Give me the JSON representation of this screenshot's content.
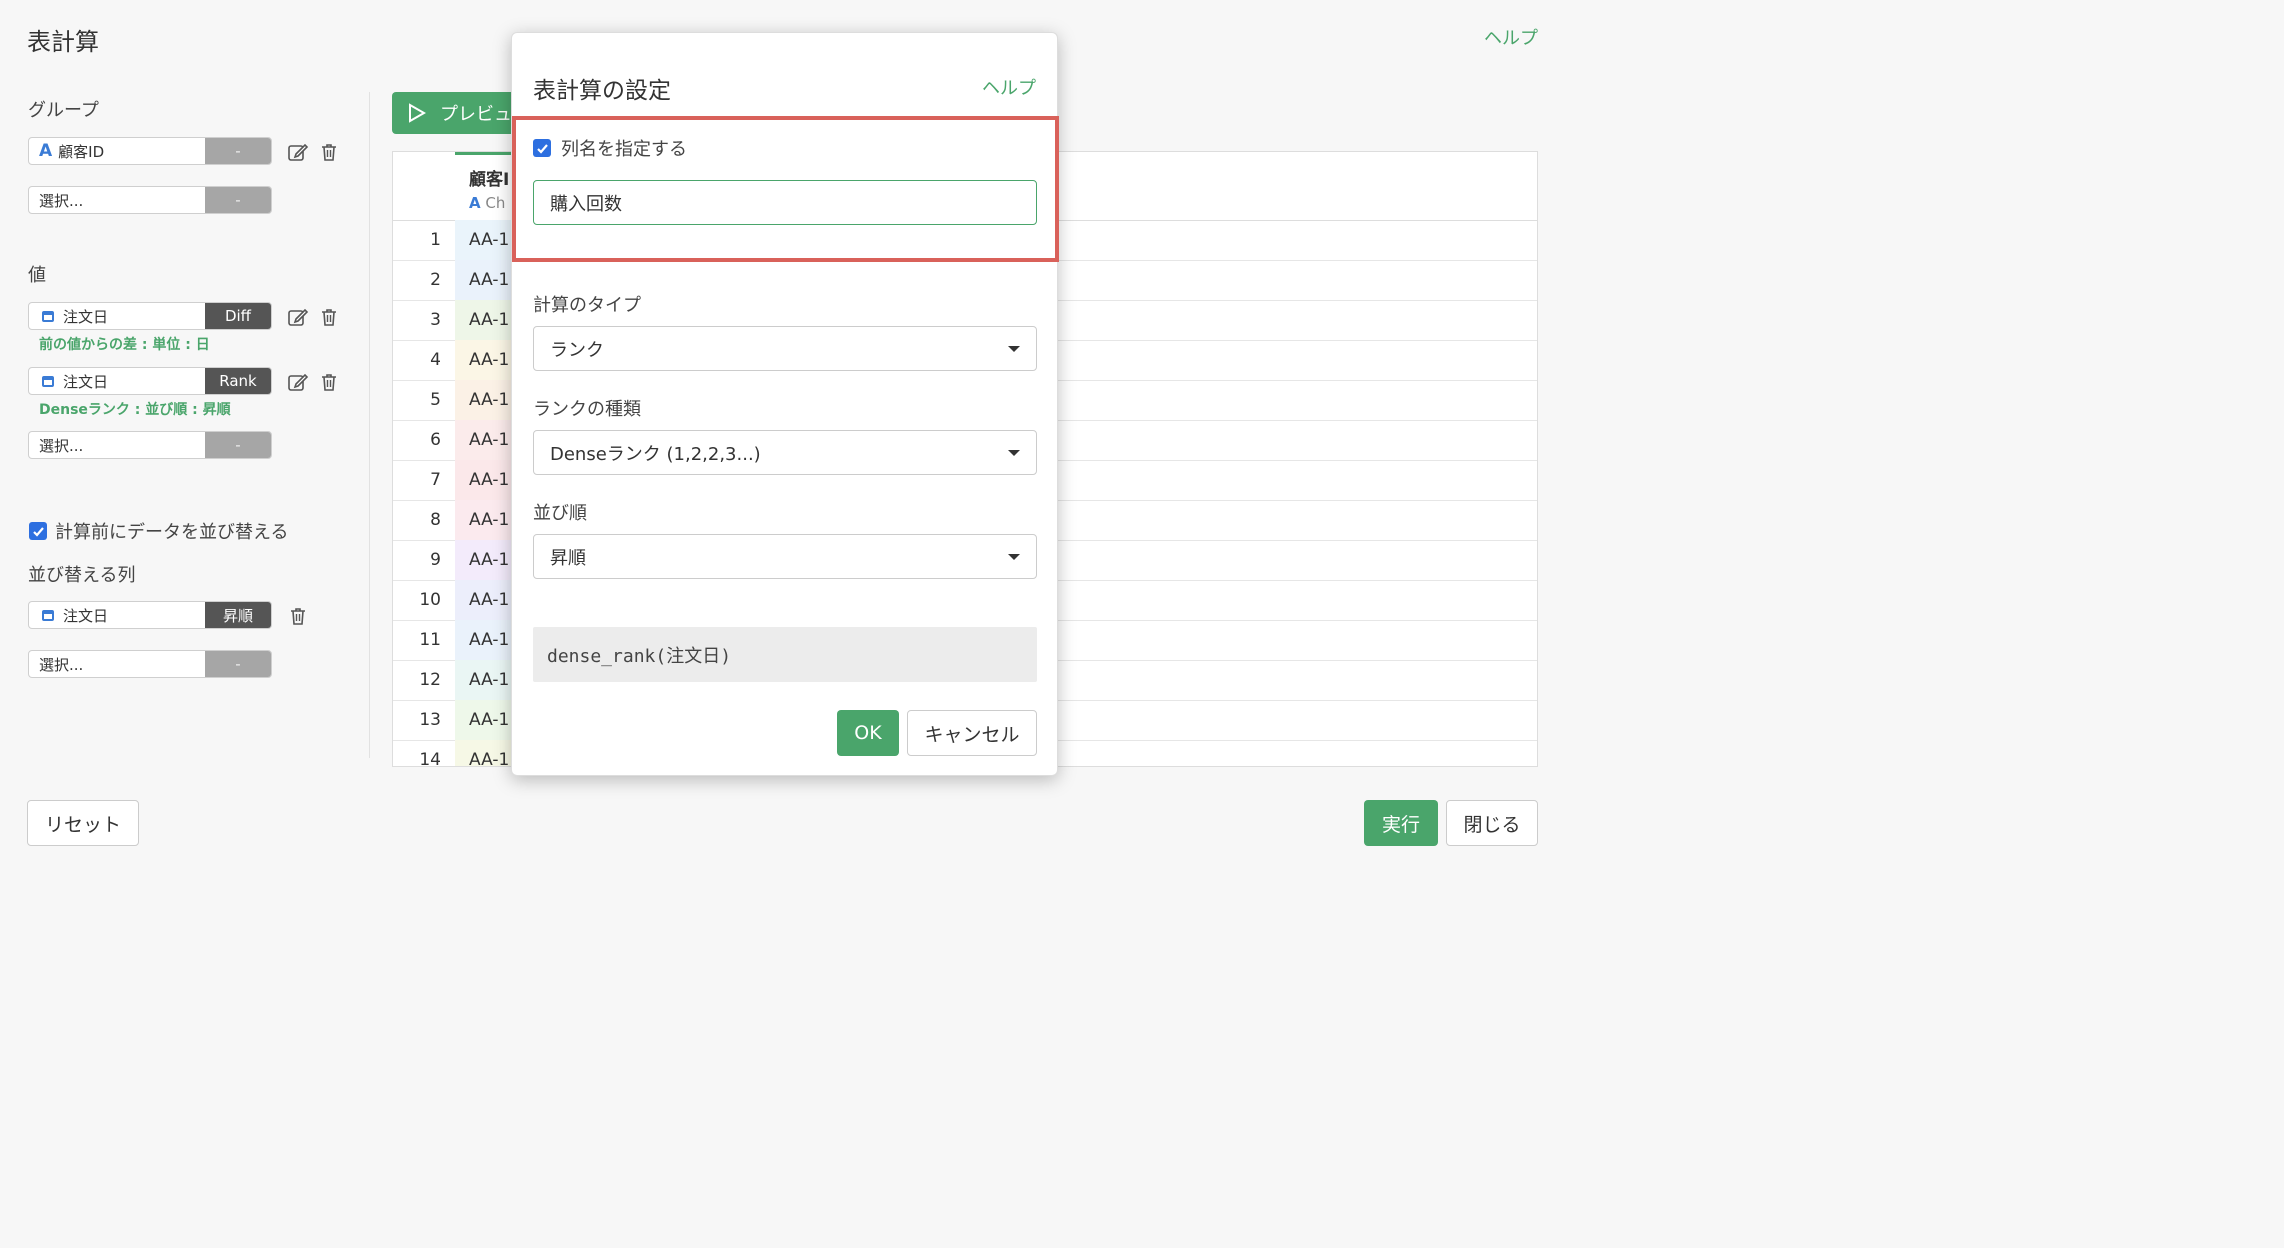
{
  "page": {
    "title": "表計算",
    "help": "ヘルプ"
  },
  "group": {
    "label": "グループ",
    "items": [
      {
        "icon": "string-type-icon",
        "type_glyph": "A",
        "name": "顧客ID",
        "tag": "-"
      },
      {
        "name": "選択...",
        "tag": "-"
      }
    ]
  },
  "values": {
    "label": "値",
    "items": [
      {
        "icon": "calendar-icon",
        "name": "注文日",
        "tag": "Diff",
        "note": "前の値からの差 : 単位 : 日"
      },
      {
        "icon": "calendar-icon",
        "name": "注文日",
        "tag": "Rank",
        "note": "Denseランク : 並び順 : 昇順"
      },
      {
        "name": "選択...",
        "tag": "-"
      }
    ]
  },
  "sort": {
    "checkbox_label": "計算前にデータを並び替える",
    "checked": true,
    "columns_label": "並び替える列",
    "items": [
      {
        "icon": "calendar-icon",
        "name": "注文日",
        "tag": "昇順"
      },
      {
        "name": "選択...",
        "tag": "-"
      }
    ]
  },
  "preview": {
    "button_label": "プレビュー",
    "column": {
      "name": "顧客I",
      "type_glyph": "A",
      "type_label": "Ch"
    },
    "rows": [
      {
        "num": "1",
        "val": "AA-1"
      },
      {
        "num": "2",
        "val": "AA-1"
      },
      {
        "num": "3",
        "val": "AA-1"
      },
      {
        "num": "4",
        "val": "AA-1"
      },
      {
        "num": "5",
        "val": "AA-1"
      },
      {
        "num": "6",
        "val": "AA-1"
      },
      {
        "num": "7",
        "val": "AA-1"
      },
      {
        "num": "8",
        "val": "AA-1"
      },
      {
        "num": "9",
        "val": "AA-1"
      },
      {
        "num": "10",
        "val": "AA-1"
      },
      {
        "num": "11",
        "val": "AA-1"
      },
      {
        "num": "12",
        "val": "AA-1"
      },
      {
        "num": "13",
        "val": "AA-1"
      },
      {
        "num": "14",
        "val": "AA-1"
      }
    ]
  },
  "footer": {
    "reset": "リセット",
    "run": "実行",
    "close": "閉じる"
  },
  "modal": {
    "title": "表計算の設定",
    "help": "ヘルプ",
    "specify_name_label": "列名を指定する",
    "specify_name_checked": true,
    "column_name_value": "購入回数",
    "calc_type_label": "計算のタイプ",
    "calc_type_value": "ランク",
    "rank_kind_label": "ランクの種類",
    "rank_kind_value": "Denseランク (1,2,2,3...)",
    "order_label": "並び順",
    "order_value": "昇順",
    "formula": "dense_rank(注文日)",
    "ok": "OK",
    "cancel": "キャンセル"
  },
  "colors": {
    "accent_green": "#4aa56b",
    "highlight_red": "#d9615a",
    "checkbox_blue": "#2d6fe0",
    "tag_dark": "#555555",
    "tag_gray": "#a6a6a6"
  }
}
